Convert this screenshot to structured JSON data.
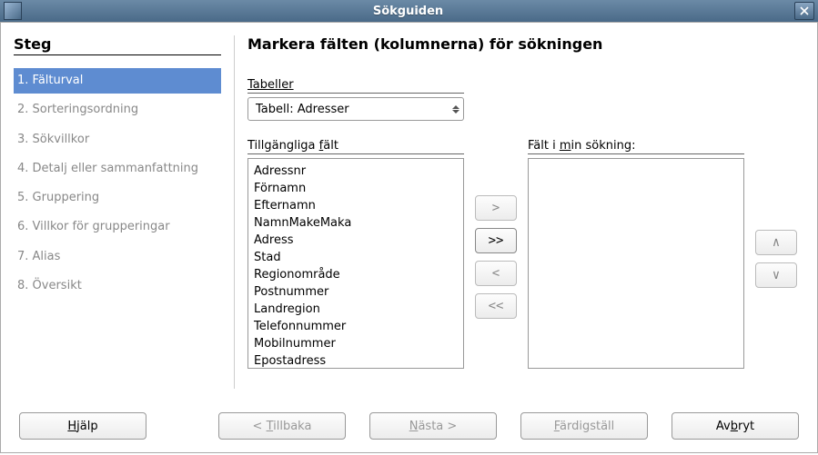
{
  "window": {
    "title": "Sökguiden"
  },
  "sidebar": {
    "heading": "Steg",
    "steps": [
      "1. Fälturval",
      "2. Sorteringsordning",
      "3. Sökvillkor",
      "4. Detalj eller sammanfattning",
      "5. Gruppering",
      "6. Villkor för grupperingar",
      "7. Alias",
      "8. Översikt"
    ],
    "current_index": 0
  },
  "content": {
    "heading": "Markera fälten (kolumnerna) för sökningen",
    "tables_label": "Tabeller",
    "table_selected": "Tabell: Adresser",
    "available_label_pre": "Tillgängliga ",
    "available_label_u": "f",
    "available_label_post": "ält",
    "selected_label_pre": "Fält i ",
    "selected_label_u": "m",
    "selected_label_post": "in sökning:",
    "available_fields": [
      "Adressnr",
      "Förnamn",
      "Efternamn",
      "NamnMakeMaka",
      "Adress",
      "Stad",
      "Regionområde",
      "Postnummer",
      "Landregion",
      "Telefonnummer",
      "Mobilnummer",
      "Epostadress"
    ],
    "selected_fields": [],
    "move": {
      "add_one": ">",
      "add_all": ">>",
      "remove_one": "<",
      "remove_all": "<<",
      "up": "∧",
      "down": "∨"
    }
  },
  "buttons": {
    "help_u": "H",
    "help_post": "jälp",
    "back_pre": "< ",
    "back_u": "T",
    "back_post": "illbaka",
    "next_u": "N",
    "next_post": "ästa >",
    "finish_u": "F",
    "finish_post": "ärdigställ",
    "cancel_pre": "Av",
    "cancel_u": "b",
    "cancel_post": "ryt"
  }
}
